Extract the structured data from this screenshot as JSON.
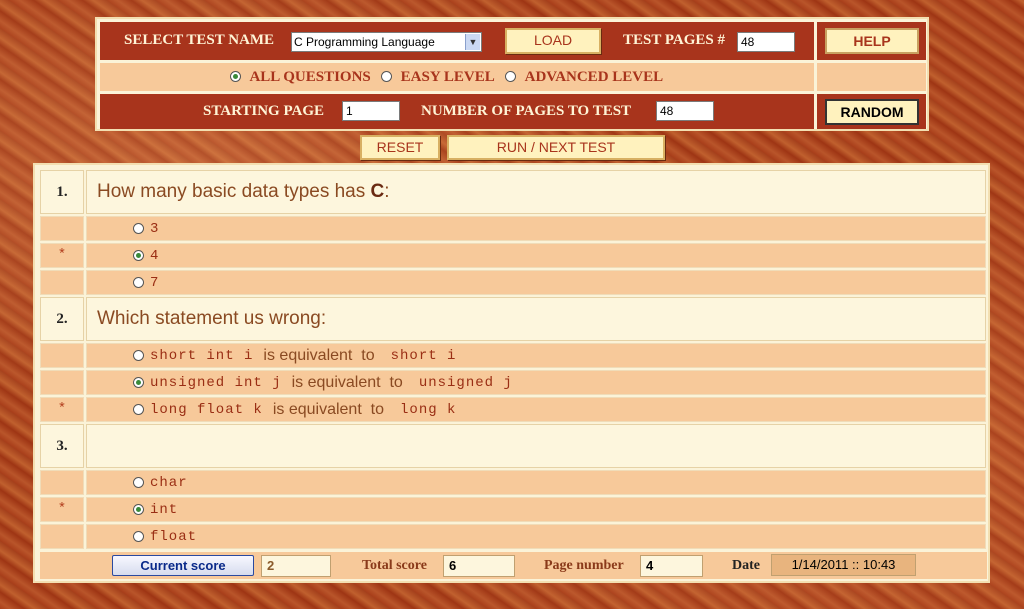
{
  "header": {
    "select_label": "SELECT TEST NAME",
    "test_name": "C Programming Language",
    "load_label": "LOAD",
    "test_pages_label": "TEST PAGES #",
    "test_pages_value": "48",
    "help_label": "HELP",
    "level_options": [
      {
        "label": "ALL QUESTIONS",
        "selected": true
      },
      {
        "label": "EASY LEVEL",
        "selected": false
      },
      {
        "label": "ADVANCED LEVEL",
        "selected": false
      }
    ],
    "starting_page_label": "STARTING PAGE",
    "starting_page_value": "1",
    "num_pages_label": "NUMBER OF PAGES TO TEST",
    "num_pages_value": "48",
    "random_label": "RANDOM"
  },
  "actions": {
    "reset_label": "RESET",
    "run_label": "RUN / NEXT TEST"
  },
  "questions": [
    {
      "number": "1.",
      "text_plain": "How many basic data types has ",
      "text_bold": "C",
      "text_tail": ":",
      "answers": [
        {
          "mark": "",
          "text": "3",
          "selected": false
        },
        {
          "mark": "*",
          "text": "4",
          "selected": true
        },
        {
          "mark": "",
          "text": "7",
          "selected": false
        }
      ]
    },
    {
      "number": "2.",
      "text_plain": "Which statement us wrong:",
      "answers": [
        {
          "mark": "",
          "code1": "short int i",
          "mid": "is equivalent  to",
          "code2": "short i",
          "selected": false
        },
        {
          "mark": "",
          "code1": "unsigned int j",
          "mid": "is equivalent  to",
          "code2": "unsigned j",
          "selected": true
        },
        {
          "mark": "*",
          "code1": "long float k",
          "mid": "is equivalent  to",
          "code2": "long k",
          "selected": false
        }
      ]
    },
    {
      "number": "3.",
      "text_plain": "",
      "answers": [
        {
          "mark": "",
          "text": "char",
          "selected": false
        },
        {
          "mark": "*",
          "text": "int",
          "selected": true
        },
        {
          "mark": "",
          "text": "float",
          "selected": false
        }
      ]
    }
  ],
  "footer": {
    "current_score_label": "Current score",
    "current_score_value": "2",
    "total_score_label": "Total score",
    "total_score_value": "6",
    "page_number_label": "Page number",
    "page_number_value": "4",
    "date_label": "Date",
    "date_value": "1/14/2011 :: 10:43"
  }
}
